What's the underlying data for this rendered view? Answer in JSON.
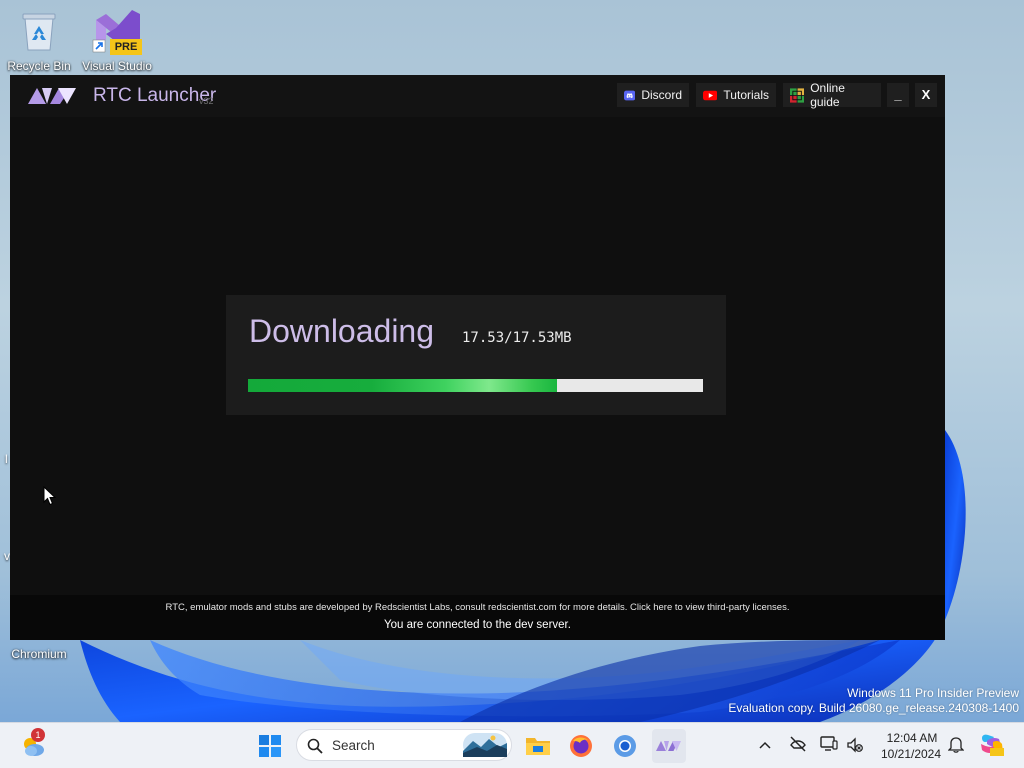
{
  "desktop": {
    "icons": [
      {
        "label": "Recycle Bin"
      },
      {
        "label": "Visual Studio",
        "badge": "PRE"
      },
      {
        "label": "Chromium"
      }
    ],
    "edge_glyphs": [
      "l",
      "v"
    ],
    "watermark": {
      "line1": "Windows 11 Pro Insider Preview",
      "line2": "Evaluation copy. Build 26080.ge_release.240308-1400"
    }
  },
  "rtc": {
    "title": "RTC Launcher",
    "version": "v32",
    "header_buttons": [
      {
        "label": "Discord",
        "icon": "discord-icon",
        "color": "#5865F2"
      },
      {
        "label": "Tutorials",
        "icon": "youtube-icon",
        "color": "#FF0000"
      },
      {
        "label": "Online guide",
        "icon": "guide-icon",
        "color": "#2ea043"
      }
    ],
    "minimize_label": "_",
    "close_label": "X",
    "download": {
      "title": "Downloading",
      "size": "17.53/17.53MB",
      "progress": 0.68
    },
    "footer": {
      "credits": "RTC, emulator mods and stubs are developed by Redscientist Labs, consult redscientist.com for more details. Click here to view third-party licenses.",
      "status": "You are connected to the dev server."
    },
    "accent_color": "#c9b6ea"
  },
  "taskbar": {
    "search_placeholder": "Search",
    "weather_badge": "1",
    "pinned": [
      "windows-start-icon",
      "file-explorer-icon",
      "firefox-icon",
      "chromium-icon",
      "rtc-icon"
    ],
    "clock": {
      "time": "12:04 AM",
      "date": "10/21/2024"
    }
  }
}
